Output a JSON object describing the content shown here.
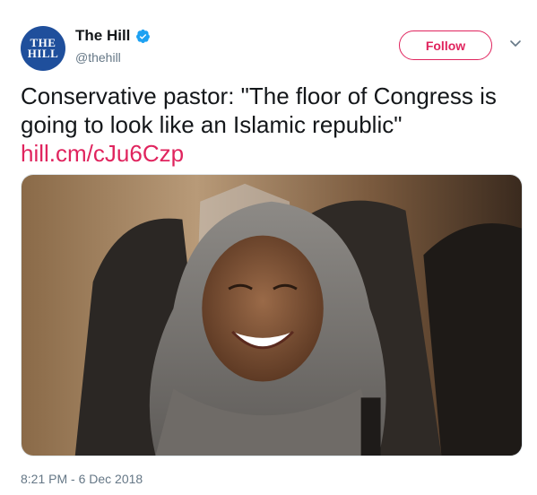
{
  "account": {
    "display_name": "The Hill",
    "handle": "@thehill",
    "avatar_text_line1": "THE",
    "avatar_text_line2": "HILL",
    "verified": true
  },
  "actions": {
    "follow_label": "Follow",
    "more_icon": "chevron-down-icon"
  },
  "tweet": {
    "text": "Conservative pastor: \"The floor of Congress is going to look like an Islamic republic\"",
    "link": "hill.cm/cJu6Czp",
    "timestamp": "8:21 PM - 6 Dec 2018"
  },
  "media": {
    "type": "photo",
    "description_icon": "photo-of-smiling-woman-in-grey-hijab"
  },
  "colors": {
    "accent": "#e0245e",
    "secondary_text": "#657786",
    "verified_blue": "#1da1f2",
    "avatar_bg": "#1f4f9c"
  }
}
